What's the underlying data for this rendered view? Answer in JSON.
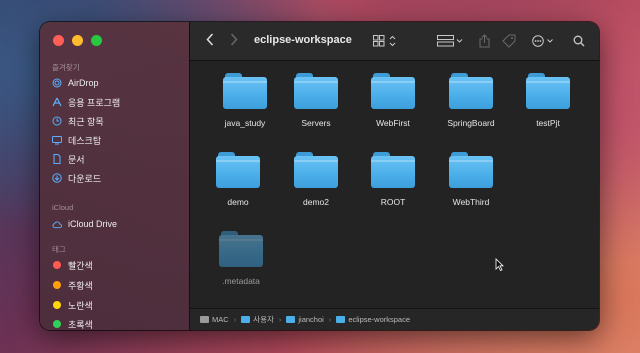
{
  "window": {
    "title": "eclipse-workspace"
  },
  "sidebar": {
    "favorites_header": "즐겨찾기",
    "favorites": [
      {
        "label": "AirDrop",
        "icon": "airdrop-icon"
      },
      {
        "label": "응용 프로그램",
        "icon": "applications-icon"
      },
      {
        "label": "최근 항목",
        "icon": "recents-icon"
      },
      {
        "label": "데스크탑",
        "icon": "desktop-icon"
      },
      {
        "label": "문서",
        "icon": "document-icon"
      },
      {
        "label": "다운로드",
        "icon": "download-icon"
      }
    ],
    "icloud_header": "iCloud",
    "icloud": [
      {
        "label": "iCloud Drive",
        "icon": "icloud-icon"
      }
    ],
    "tags_header": "태그",
    "tags": [
      {
        "label": "빨간색",
        "color": "#ff5a52"
      },
      {
        "label": "주황색",
        "color": "#ff9f0a"
      },
      {
        "label": "노란색",
        "color": "#ffd60a"
      },
      {
        "label": "초록색",
        "color": "#30d158"
      }
    ]
  },
  "files": [
    {
      "name": "java_study",
      "dimmed": false
    },
    {
      "name": "Servers",
      "dimmed": false
    },
    {
      "name": "WebFirst",
      "dimmed": false
    },
    {
      "name": "SpringBoard",
      "dimmed": false
    },
    {
      "name": "testPjt",
      "dimmed": false
    },
    {
      "name": "demo",
      "dimmed": false
    },
    {
      "name": "demo2",
      "dimmed": false
    },
    {
      "name": "ROOT",
      "dimmed": false
    },
    {
      "name": "WebThird",
      "dimmed": false
    },
    {
      "name": ".metadata",
      "dimmed": true
    }
  ],
  "pathbar": [
    {
      "label": "MAC",
      "icon": "hard-drive-icon"
    },
    {
      "label": "사용자",
      "icon": "folder-icon"
    },
    {
      "label": "jianchoi",
      "icon": "folder-icon"
    },
    {
      "label": "eclipse-workspace",
      "icon": "folder-icon"
    }
  ],
  "toolbar_icons": [
    "back-icon",
    "forward-icon",
    "view-grid-icon",
    "group-icon",
    "share-icon",
    "tag-icon",
    "more-icon",
    "search-icon"
  ],
  "colors": {
    "folder": "#4aaee9",
    "accent": "#5ab0ff"
  }
}
